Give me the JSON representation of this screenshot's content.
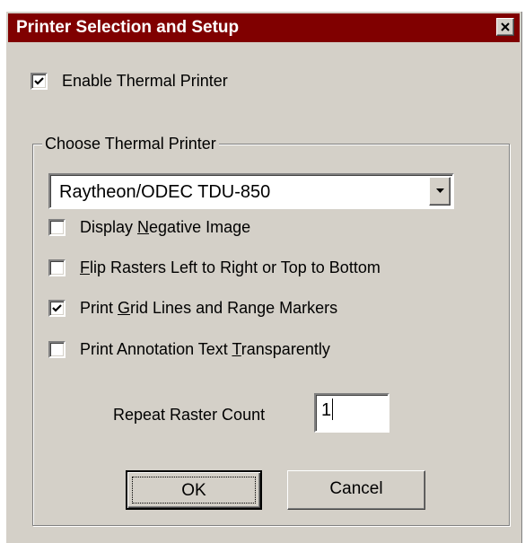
{
  "window": {
    "title": "Printer Selection and Setup",
    "close_icon": "close-icon",
    "colors": {
      "title_bar": "#800000",
      "dialog_face": "#d4d0c8"
    }
  },
  "enable_thermal_printer": {
    "label": "Enable Thermal Printer",
    "checked": true
  },
  "group": {
    "label": "Choose Thermal Printer",
    "printer_select": {
      "selected": "Raytheon/ODEC TDU-850",
      "icon": "chevron-down-icon"
    },
    "options": [
      {
        "pre": "Display ",
        "accel": "N",
        "post": "egative Image",
        "checked": false
      },
      {
        "pre": "",
        "accel": "F",
        "post": "lip Rasters Left to Right or Top to Bottom",
        "checked": false
      },
      {
        "pre": "Print ",
        "accel": "G",
        "post": "rid Lines and Range Markers",
        "checked": true
      },
      {
        "pre": "Print Annotation Text ",
        "accel": "T",
        "post": "ransparently",
        "checked": false
      }
    ],
    "repeat_raster": {
      "label": "Repeat Raster Count",
      "value": "1"
    }
  },
  "buttons": {
    "ok": "OK",
    "cancel": "Cancel"
  }
}
